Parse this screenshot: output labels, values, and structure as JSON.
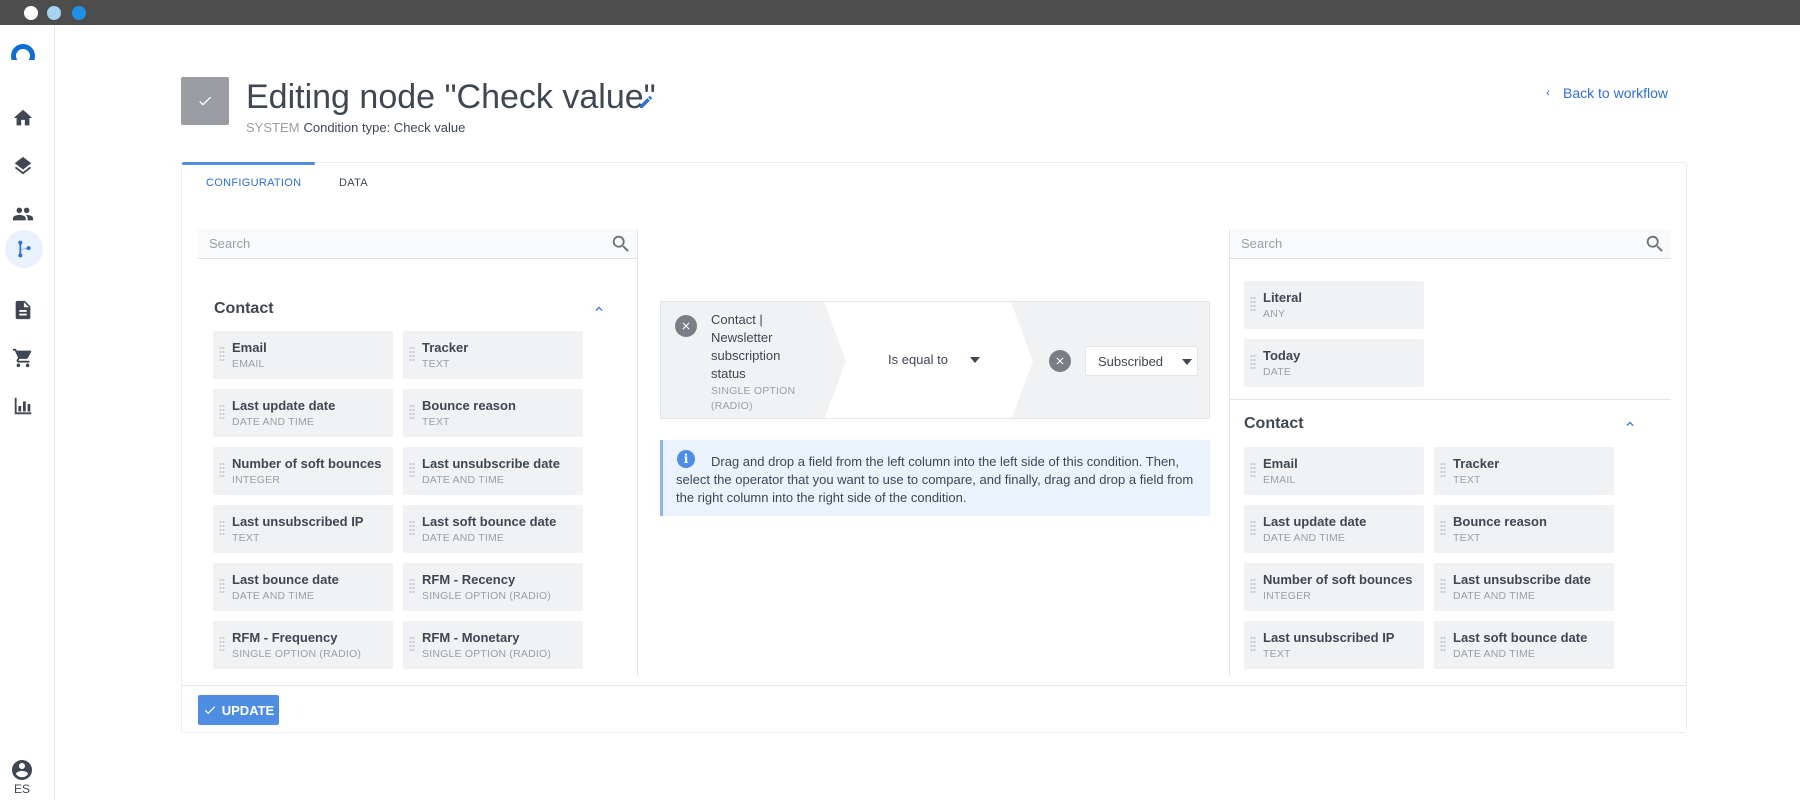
{
  "window": {
    "controls": [
      "close",
      "minimize",
      "maximize"
    ]
  },
  "sidebar": {
    "items": [
      {
        "id": "home",
        "icon": "home-icon"
      },
      {
        "id": "layers",
        "icon": "layers-icon"
      },
      {
        "id": "contacts",
        "icon": "people-icon"
      },
      {
        "id": "workflows",
        "icon": "workflow-icon",
        "active": true
      },
      {
        "id": "documents",
        "icon": "document-icon"
      },
      {
        "id": "ecommerce",
        "icon": "cart-icon"
      },
      {
        "id": "reports",
        "icon": "bar-chart-icon"
      }
    ],
    "user_language": "ES"
  },
  "header": {
    "title": "Editing node \"Check value\"",
    "system_label": "SYSTEM",
    "condition_type": "Condition type: Check value",
    "back_link": "Back to workflow"
  },
  "tabs": [
    {
      "label": "CONFIGURATION",
      "active": true
    },
    {
      "label": "DATA",
      "active": false
    }
  ],
  "left_panel": {
    "search_placeholder": "Search",
    "section_title": "Contact",
    "fields": [
      {
        "name": "Email",
        "type": "EMAIL"
      },
      {
        "name": "Tracker",
        "type": "TEXT"
      },
      {
        "name": "Last update date",
        "type": "DATE AND TIME"
      },
      {
        "name": "Bounce reason",
        "type": "TEXT"
      },
      {
        "name": "Number of soft bounces",
        "type": "INTEGER"
      },
      {
        "name": "Last unsubscribe date",
        "type": "DATE AND TIME"
      },
      {
        "name": "Last unsubscribed IP",
        "type": "TEXT"
      },
      {
        "name": "Last soft bounce date",
        "type": "DATE AND TIME"
      },
      {
        "name": "Last bounce date",
        "type": "DATE AND TIME"
      },
      {
        "name": "RFM - Recency",
        "type": "SINGLE OPTION (RADIO)"
      },
      {
        "name": "RFM - Frequency",
        "type": "SINGLE OPTION (RADIO)"
      },
      {
        "name": "RFM - Monetary",
        "type": "SINGLE OPTION (RADIO)"
      }
    ]
  },
  "condition": {
    "left_field": "Contact | Newsletter subscription status",
    "left_field_type": "SINGLE OPTION (RADIO)",
    "operator": "Is equal to",
    "right_value": "Subscribed"
  },
  "hint": {
    "text": "Drag and drop a field from the left column into the left side of this condition. Then, select the operator that you want to use to compare, and finally, drag and drop a field from the right column into the right side of the condition."
  },
  "right_panel": {
    "search_placeholder": "Search",
    "generic_fields": [
      {
        "name": "Literal",
        "type": "ANY"
      },
      {
        "name": "Today",
        "type": "DATE"
      }
    ],
    "section_title": "Contact",
    "fields": [
      {
        "name": "Email",
        "type": "EMAIL"
      },
      {
        "name": "Tracker",
        "type": "TEXT"
      },
      {
        "name": "Last update date",
        "type": "DATE AND TIME"
      },
      {
        "name": "Bounce reason",
        "type": "TEXT"
      },
      {
        "name": "Number of soft bounces",
        "type": "INTEGER"
      },
      {
        "name": "Last unsubscribe date",
        "type": "DATE AND TIME"
      },
      {
        "name": "Last unsubscribed IP",
        "type": "TEXT"
      },
      {
        "name": "Last soft bounce date",
        "type": "DATE AND TIME"
      }
    ]
  },
  "footer": {
    "update_label": "UPDATE"
  },
  "colors": {
    "accent": "#2f6fd6",
    "button": "#4f8de3",
    "field_bg": "#f1f2f3",
    "hint_bg": "#e9f2fd"
  }
}
